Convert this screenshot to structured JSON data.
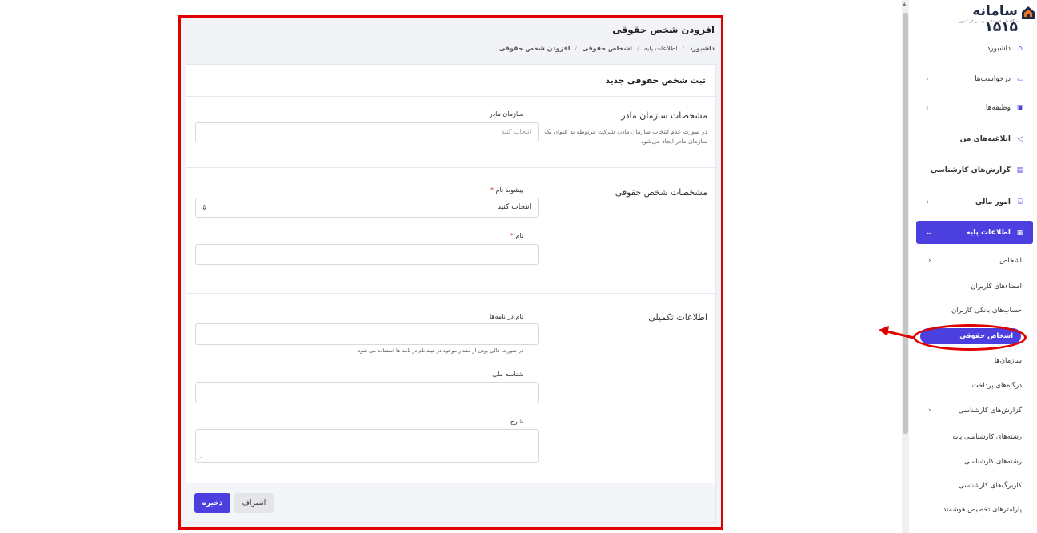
{
  "page": {
    "title": "افزودن شخص حقوقی",
    "breadcrumb": [
      "داشبورد",
      "اطلاعات پایه",
      "اشخاص حقوقی",
      "افزودن شخص حقوقی"
    ]
  },
  "form": {
    "card_title": "ثبت شخص حقوقی جدید",
    "parent_section": {
      "title": "مشخصات سازمان مادر",
      "description": "در صورت عدم انتخاب سازمان مادر، شرکت مربوطه به عنوان یک سازمان مادر ایجاد می‌شود",
      "field_label": "سازمان مادر",
      "placeholder": "انتخاب کنید"
    },
    "legal_section": {
      "title": "مشخصات شخص حقوقی",
      "prefix_label": "پیشوند نام",
      "prefix_value": "انتخاب کنید",
      "name_label": "نام",
      "required_mark": "*"
    },
    "extra_section": {
      "title": "اطلاعات تکمیلی",
      "letter_name_label": "نام در نامه‌ها",
      "letter_name_hint": "در صورت خالی بودن از مقدار موجود در فیلد نام در نامه ها استفاده می شود",
      "national_id_label": "شناسه ملی",
      "description_label": "شرح"
    },
    "buttons": {
      "save": "ذخیره",
      "cancel": "انصراف"
    }
  },
  "sidebar": {
    "brand": {
      "name": "سامانه ۱۵۱۵",
      "tagline": "درگاه ملی کارشناسی رسمی کل کشور"
    },
    "items": [
      {
        "label": "داشبورد",
        "icon": "home-icon"
      },
      {
        "label": "درخواست‌ها",
        "icon": "inbox-icon"
      },
      {
        "label": "وظیفه‌ها",
        "icon": "clipboard-icon"
      },
      {
        "label": "ابلاغیه‌های من",
        "icon": "megaphone-icon"
      },
      {
        "label": "گزارش‌های کارشناسی",
        "icon": "chart-icon"
      },
      {
        "label": "امور مالی",
        "icon": "bank-icon"
      },
      {
        "label": "اطلاعات پایه",
        "icon": "database-icon"
      }
    ],
    "sub_items": [
      "اشخاص",
      "امضاءهای کاربران",
      "حساب‌های بانکی کاربران",
      "اشخاص حقوقی",
      "سازمان‌ها",
      "درگاه‌های پرداخت",
      "گزارش‌های کارشناسی",
      "رشته‌های کارشناسی پایه",
      "رشته‌های کارشناسی",
      "کاربرگ‌های کارشناسی",
      "پارامترهای تخصیص هوشمند"
    ]
  },
  "colors": {
    "accent": "#4b3fe0",
    "highlight": "#e00000"
  }
}
